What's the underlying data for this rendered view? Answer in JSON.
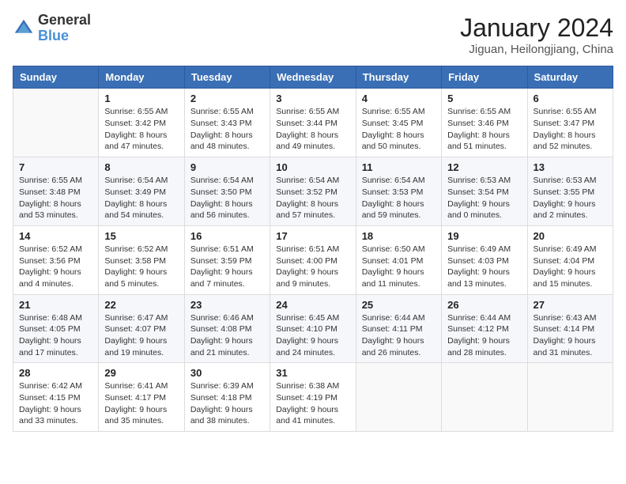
{
  "header": {
    "logo_general": "General",
    "logo_blue": "Blue",
    "title": "January 2024",
    "location": "Jiguan, Heilongjiang, China"
  },
  "weekdays": [
    "Sunday",
    "Monday",
    "Tuesday",
    "Wednesday",
    "Thursday",
    "Friday",
    "Saturday"
  ],
  "weeks": [
    [
      {
        "day": "",
        "sunrise": "",
        "sunset": "",
        "daylight": ""
      },
      {
        "day": "1",
        "sunrise": "Sunrise: 6:55 AM",
        "sunset": "Sunset: 3:42 PM",
        "daylight": "Daylight: 8 hours and 47 minutes."
      },
      {
        "day": "2",
        "sunrise": "Sunrise: 6:55 AM",
        "sunset": "Sunset: 3:43 PM",
        "daylight": "Daylight: 8 hours and 48 minutes."
      },
      {
        "day": "3",
        "sunrise": "Sunrise: 6:55 AM",
        "sunset": "Sunset: 3:44 PM",
        "daylight": "Daylight: 8 hours and 49 minutes."
      },
      {
        "day": "4",
        "sunrise": "Sunrise: 6:55 AM",
        "sunset": "Sunset: 3:45 PM",
        "daylight": "Daylight: 8 hours and 50 minutes."
      },
      {
        "day": "5",
        "sunrise": "Sunrise: 6:55 AM",
        "sunset": "Sunset: 3:46 PM",
        "daylight": "Daylight: 8 hours and 51 minutes."
      },
      {
        "day": "6",
        "sunrise": "Sunrise: 6:55 AM",
        "sunset": "Sunset: 3:47 PM",
        "daylight": "Daylight: 8 hours and 52 minutes."
      }
    ],
    [
      {
        "day": "7",
        "sunrise": "Sunrise: 6:55 AM",
        "sunset": "Sunset: 3:48 PM",
        "daylight": "Daylight: 8 hours and 53 minutes."
      },
      {
        "day": "8",
        "sunrise": "Sunrise: 6:54 AM",
        "sunset": "Sunset: 3:49 PM",
        "daylight": "Daylight: 8 hours and 54 minutes."
      },
      {
        "day": "9",
        "sunrise": "Sunrise: 6:54 AM",
        "sunset": "Sunset: 3:50 PM",
        "daylight": "Daylight: 8 hours and 56 minutes."
      },
      {
        "day": "10",
        "sunrise": "Sunrise: 6:54 AM",
        "sunset": "Sunset: 3:52 PM",
        "daylight": "Daylight: 8 hours and 57 minutes."
      },
      {
        "day": "11",
        "sunrise": "Sunrise: 6:54 AM",
        "sunset": "Sunset: 3:53 PM",
        "daylight": "Daylight: 8 hours and 59 minutes."
      },
      {
        "day": "12",
        "sunrise": "Sunrise: 6:53 AM",
        "sunset": "Sunset: 3:54 PM",
        "daylight": "Daylight: 9 hours and 0 minutes."
      },
      {
        "day": "13",
        "sunrise": "Sunrise: 6:53 AM",
        "sunset": "Sunset: 3:55 PM",
        "daylight": "Daylight: 9 hours and 2 minutes."
      }
    ],
    [
      {
        "day": "14",
        "sunrise": "Sunrise: 6:52 AM",
        "sunset": "Sunset: 3:56 PM",
        "daylight": "Daylight: 9 hours and 4 minutes."
      },
      {
        "day": "15",
        "sunrise": "Sunrise: 6:52 AM",
        "sunset": "Sunset: 3:58 PM",
        "daylight": "Daylight: 9 hours and 5 minutes."
      },
      {
        "day": "16",
        "sunrise": "Sunrise: 6:51 AM",
        "sunset": "Sunset: 3:59 PM",
        "daylight": "Daylight: 9 hours and 7 minutes."
      },
      {
        "day": "17",
        "sunrise": "Sunrise: 6:51 AM",
        "sunset": "Sunset: 4:00 PM",
        "daylight": "Daylight: 9 hours and 9 minutes."
      },
      {
        "day": "18",
        "sunrise": "Sunrise: 6:50 AM",
        "sunset": "Sunset: 4:01 PM",
        "daylight": "Daylight: 9 hours and 11 minutes."
      },
      {
        "day": "19",
        "sunrise": "Sunrise: 6:49 AM",
        "sunset": "Sunset: 4:03 PM",
        "daylight": "Daylight: 9 hours and 13 minutes."
      },
      {
        "day": "20",
        "sunrise": "Sunrise: 6:49 AM",
        "sunset": "Sunset: 4:04 PM",
        "daylight": "Daylight: 9 hours and 15 minutes."
      }
    ],
    [
      {
        "day": "21",
        "sunrise": "Sunrise: 6:48 AM",
        "sunset": "Sunset: 4:05 PM",
        "daylight": "Daylight: 9 hours and 17 minutes."
      },
      {
        "day": "22",
        "sunrise": "Sunrise: 6:47 AM",
        "sunset": "Sunset: 4:07 PM",
        "daylight": "Daylight: 9 hours and 19 minutes."
      },
      {
        "day": "23",
        "sunrise": "Sunrise: 6:46 AM",
        "sunset": "Sunset: 4:08 PM",
        "daylight": "Daylight: 9 hours and 21 minutes."
      },
      {
        "day": "24",
        "sunrise": "Sunrise: 6:45 AM",
        "sunset": "Sunset: 4:10 PM",
        "daylight": "Daylight: 9 hours and 24 minutes."
      },
      {
        "day": "25",
        "sunrise": "Sunrise: 6:44 AM",
        "sunset": "Sunset: 4:11 PM",
        "daylight": "Daylight: 9 hours and 26 minutes."
      },
      {
        "day": "26",
        "sunrise": "Sunrise: 6:44 AM",
        "sunset": "Sunset: 4:12 PM",
        "daylight": "Daylight: 9 hours and 28 minutes."
      },
      {
        "day": "27",
        "sunrise": "Sunrise: 6:43 AM",
        "sunset": "Sunset: 4:14 PM",
        "daylight": "Daylight: 9 hours and 31 minutes."
      }
    ],
    [
      {
        "day": "28",
        "sunrise": "Sunrise: 6:42 AM",
        "sunset": "Sunset: 4:15 PM",
        "daylight": "Daylight: 9 hours and 33 minutes."
      },
      {
        "day": "29",
        "sunrise": "Sunrise: 6:41 AM",
        "sunset": "Sunset: 4:17 PM",
        "daylight": "Daylight: 9 hours and 35 minutes."
      },
      {
        "day": "30",
        "sunrise": "Sunrise: 6:39 AM",
        "sunset": "Sunset: 4:18 PM",
        "daylight": "Daylight: 9 hours and 38 minutes."
      },
      {
        "day": "31",
        "sunrise": "Sunrise: 6:38 AM",
        "sunset": "Sunset: 4:19 PM",
        "daylight": "Daylight: 9 hours and 41 minutes."
      },
      {
        "day": "",
        "sunrise": "",
        "sunset": "",
        "daylight": ""
      },
      {
        "day": "",
        "sunrise": "",
        "sunset": "",
        "daylight": ""
      },
      {
        "day": "",
        "sunrise": "",
        "sunset": "",
        "daylight": ""
      }
    ]
  ]
}
